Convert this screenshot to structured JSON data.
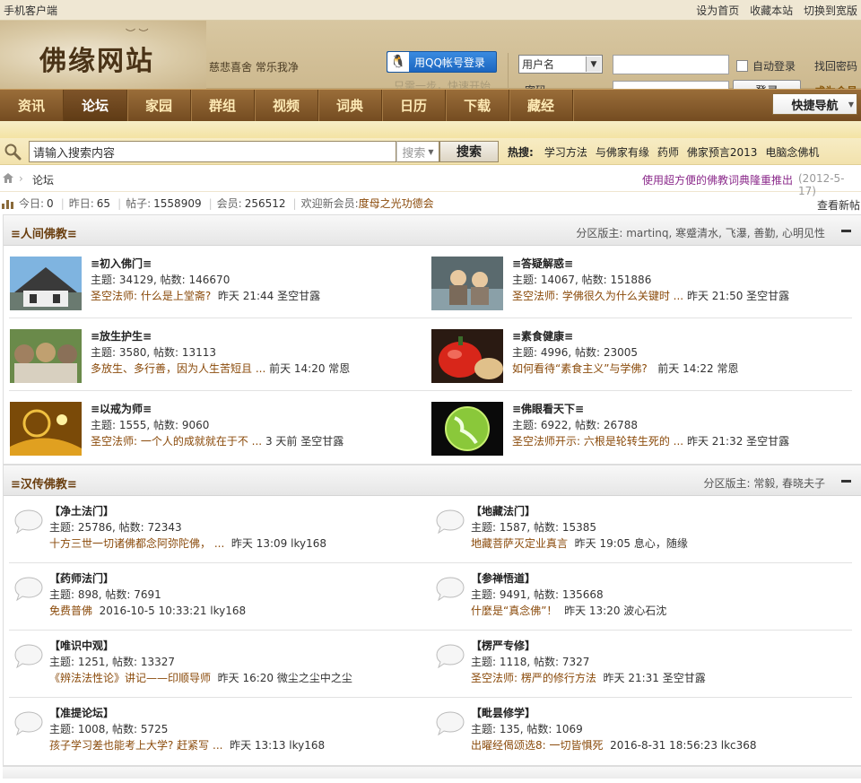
{
  "topbar": {
    "mobile": "手机客户端",
    "links": [
      "设为首页",
      "收藏本站",
      "切换到宽版"
    ]
  },
  "header": {
    "logo": "佛缘网站",
    "slogan": "慈悲喜舍 常乐我净",
    "qq_login": "用QQ帐号登录",
    "qq_hint": "只需一步，快速开始",
    "user_select": "用户名",
    "password_label": "密码",
    "auto_login": "自动登录",
    "login_button": "登录",
    "find_password": "找回密码",
    "register": "成为会员"
  },
  "nav": {
    "items": [
      "资讯",
      "论坛",
      "家园",
      "群组",
      "视频",
      "词典",
      "日历",
      "下载",
      "藏经"
    ],
    "active": "论坛",
    "quick": "快捷导航"
  },
  "search": {
    "placeholder": "请输入搜索内容",
    "type": "搜索",
    "button": "搜索",
    "hot_label": "热搜:",
    "hot": [
      "学习方法",
      "与佛家有缘",
      "药师",
      "佛家预言2013",
      "电脑念佛机"
    ]
  },
  "crumb": {
    "current": "论坛",
    "notice": "使用超方便的佛教词典隆重推出",
    "notice_date": "(2012-5-17)"
  },
  "stats": {
    "today_label": "今日:",
    "today": "0",
    "yesterday_label": "昨日:",
    "yesterday": "65",
    "posts_label": "帖子:",
    "posts": "1558909",
    "members_label": "会员:",
    "members": "256512",
    "welcome_label": "欢迎新会员:",
    "newest": "度母之光功德会",
    "view_new": "查看新帖"
  },
  "categories": [
    {
      "title": "≡人间佛教≡",
      "mods_label": "分区版主:",
      "mods": "martinq, 寒蹙清水, 飞瀑, 善勤, 心明见性",
      "forums": [
        {
          "name": "≡初入佛门≡",
          "counts": "主题: 34129, 帖数: 146670",
          "last_title": "圣空法师: 什么是上堂斋?",
          "last_meta": "昨天 21:44 圣空甘露"
        },
        {
          "name": "≡答疑解惑≡",
          "counts": "主题: 14067, 帖数: 151886",
          "last_title": "圣空法师: 学佛很久为什么关键时 ...",
          "last_meta": "昨天 21:50 圣空甘露"
        },
        {
          "name": "≡放生护生≡",
          "counts": "主题: 3580, 帖数: 13113",
          "last_title": "多放生、多行善，因为人生苦短且 ...",
          "last_meta": "前天 14:20 常恩"
        },
        {
          "name": "≡素食健康≡",
          "counts": "主题: 4996, 帖数: 23005",
          "last_title": "如何看待“素食主义”与学佛?",
          "last_meta": "前天 14:22 常恩"
        },
        {
          "name": "≡以戒为师≡",
          "counts": "主题: 1555, 帖数: 9060",
          "last_title": "圣空法师: 一个人的成就就在于不 ...",
          "last_meta": "3 天前 圣空甘露"
        },
        {
          "name": "≡佛眼看天下≡",
          "counts": "主题: 6922, 帖数: 26788",
          "last_title": "圣空法师开示: 六根是轮转生死的 ...",
          "last_meta": "昨天 21:32 圣空甘露"
        }
      ]
    },
    {
      "title": "≡汉传佛教≡",
      "mods_label": "分区版主:",
      "mods": "常毅, 春晓夫子",
      "forums": [
        {
          "name": "【净土法门】",
          "counts": "主题: 25786, 帖数: 72343",
          "last_title": "十方三世一切诸佛都念阿弥陀佛， ...",
          "last_meta": "昨天 13:09 lky168"
        },
        {
          "name": "【地藏法门】",
          "counts": "主题: 1587, 帖数: 15385",
          "last_title": "地藏菩萨灭定业真言",
          "last_meta": "昨天 19:05 息心，随缘"
        },
        {
          "name": "【药师法门】",
          "counts": "主题: 898, 帖数: 7691",
          "last_title": "免费普佛",
          "last_meta": "2016-10-5 10:33:21 lky168"
        },
        {
          "name": "【参禅悟道】",
          "counts": "主题: 9491, 帖数: 135668",
          "last_title": "什麼是“真念佛”！",
          "last_meta": "昨天 13:20 波心石沈"
        },
        {
          "name": "【唯识中观】",
          "counts": "主题: 1251, 帖数: 13327",
          "last_title": "《辨法法性论》讲记——印顺导师",
          "last_meta": "昨天 16:20 微尘之尘中之尘"
        },
        {
          "name": "【楞严专修】",
          "counts": "主题: 1118, 帖数: 7327",
          "last_title": "圣空法师: 楞严的修行方法",
          "last_meta": "昨天 21:31 圣空甘露"
        },
        {
          "name": "【准提论坛】",
          "counts": "主题: 1008, 帖数: 5725",
          "last_title": "孩子学习差也能考上大学? 赶紧写 ...",
          "last_meta": "昨天 13:13 lky168"
        },
        {
          "name": "【毗昙修学】",
          "counts": "主题: 135, 帖数: 1069",
          "last_title": "出曜经偈颂选8: 一切皆惧死",
          "last_meta": "2016-8-31 18:56:23 lkc368"
        }
      ]
    }
  ]
}
